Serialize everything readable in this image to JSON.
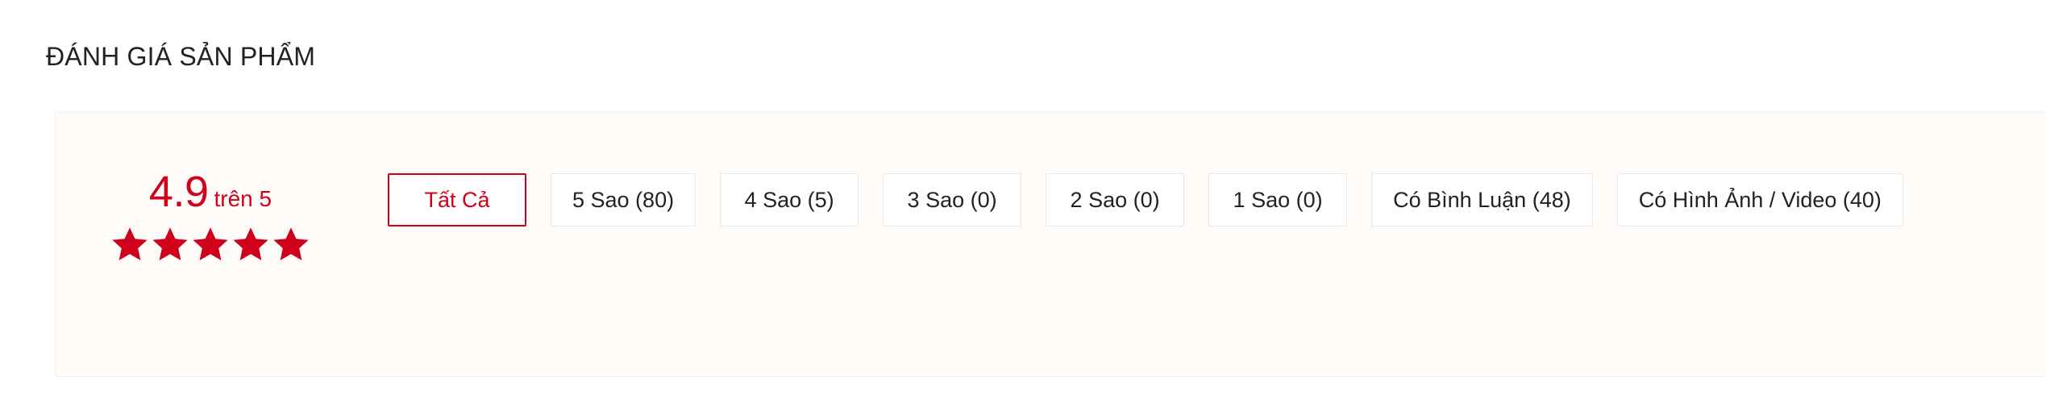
{
  "section": {
    "title": "ĐÁNH GIÁ SẢN PHẨM"
  },
  "rating_summary": {
    "score": "4.9",
    "out_of_label": "trên 5",
    "stars_filled": 5,
    "stars_total": 5,
    "star_icon": "star-icon"
  },
  "filters": {
    "buttons": [
      {
        "label": "Tất Cả",
        "active": true
      },
      {
        "label": "5 Sao (80)",
        "active": false
      },
      {
        "label": "4 Sao (5)",
        "active": false
      },
      {
        "label": "3 Sao (0)",
        "active": false
      },
      {
        "label": "2 Sao (0)",
        "active": false
      },
      {
        "label": "1 Sao (0)",
        "active": false
      },
      {
        "label": "Có Bình Luận (48)",
        "active": false
      },
      {
        "label": "Có Hình Ảnh / Video (40)",
        "active": false
      }
    ]
  },
  "colors": {
    "accent_red": "#d0011b",
    "panel_background": "#fffbf8",
    "panel_border": "#f7efe9",
    "button_border": "#e8e8e8",
    "text_primary": "#222222",
    "page_background": "#ffffff"
  }
}
